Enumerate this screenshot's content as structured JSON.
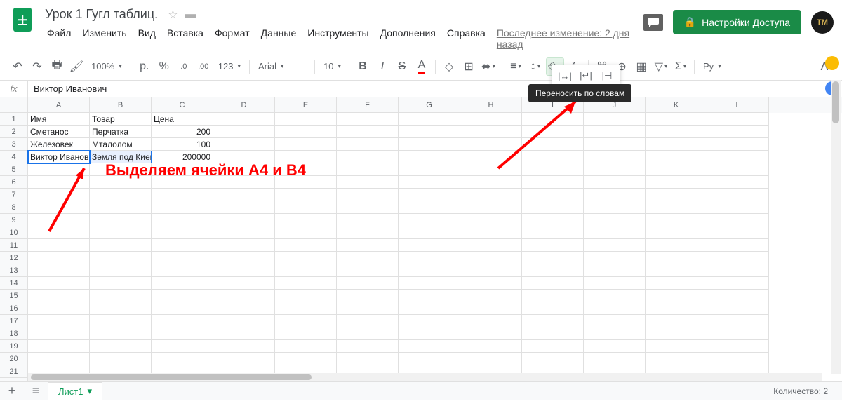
{
  "doc": {
    "title": "Урок 1 Гугл таблиц."
  },
  "menus": [
    "Файл",
    "Изменить",
    "Вид",
    "Вставка",
    "Формат",
    "Данные",
    "Инструменты",
    "Дополнения",
    "Справка"
  ],
  "last_edit": "Последнее изменение: 2 дня назад",
  "share": {
    "label": "Настройки Доступа"
  },
  "avatar": "TM",
  "toolbar": {
    "zoom": "100%",
    "currency": "p.",
    "percent": "%",
    "dec_dec": ".0",
    "dec_inc": ".00",
    "more_fmt": "123",
    "font": "Arial",
    "size": "10",
    "spell": "Ру"
  },
  "formula": {
    "fx": "fx",
    "value": "Виктор Иванович"
  },
  "columns": [
    "A",
    "B",
    "C",
    "D",
    "E",
    "F",
    "G",
    "H",
    "I",
    "J",
    "K",
    "L"
  ],
  "row_count": 22,
  "cells": {
    "r1": {
      "A": "Имя",
      "B": "Товар",
      "C": "Цена"
    },
    "r2": {
      "A": "Сметанос",
      "B": "Перчатка",
      "C": "200"
    },
    "r3": {
      "A": "Железовек",
      "B": "Мталолом",
      "C": "100"
    },
    "r4": {
      "A": "Виктор Иванови",
      "B": "Земля под Киев",
      "C": "200000"
    }
  },
  "tooltip": "Переносить по словам",
  "annotation": "Выделяем ячейки А4 и В4",
  "sheet": {
    "name": "Лист1"
  },
  "status": "Количество: 2"
}
